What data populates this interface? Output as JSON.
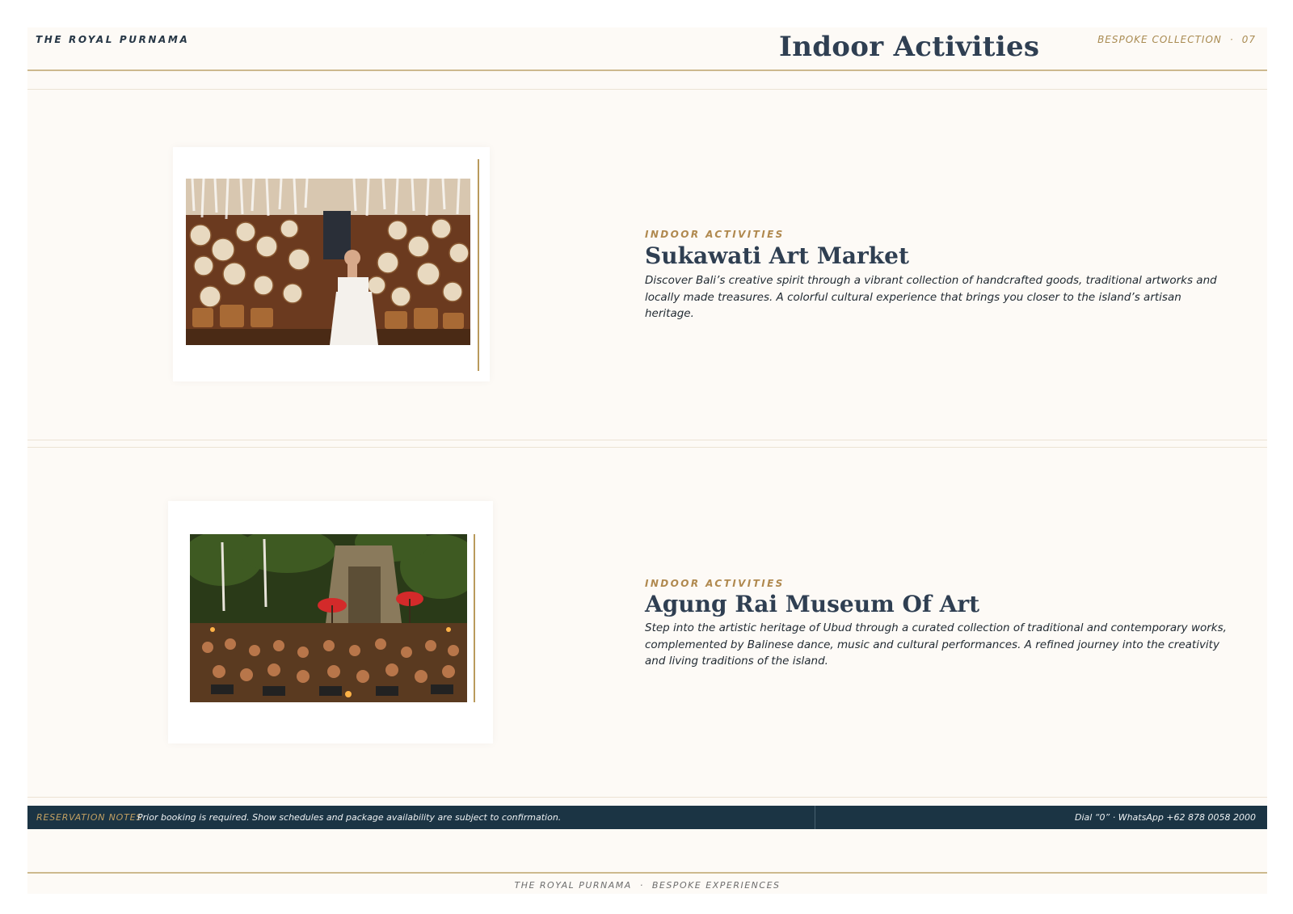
{
  "header": {
    "brand": "THE ROYAL PURNAMA",
    "title": "Indoor Activities",
    "collection_label": "BESPOKE COLLECTION",
    "separator": "·",
    "page_number": "07"
  },
  "activities": [
    {
      "eyebrow": "INDOOR ACTIVITIES",
      "title": "Sukawati Art Market",
      "description": "Discover Bali’s creative spirit through a vibrant collection of handcrafted goods, traditional artworks and locally made treasures. A colorful cultural experience that brings you closer to the island’s artisan heritage."
    },
    {
      "eyebrow": "INDOOR ACTIVITIES",
      "title": "Agung Rai Museum Of Art",
      "description": "Step into the artistic heritage of Ubud through a curated collection of traditional and contemporary works, complemented by Balinese dance, music and cultural performances. A refined journey into the creativity and living traditions of the island."
    }
  ],
  "reservation": {
    "label": "RESERVATION NOTES",
    "text": "Prior booking is required. Show schedules and package availability are subject to confirmation.",
    "contact": "Dial “0” · WhatsApp +62 878 0058 2000"
  },
  "footer": {
    "brand": "THE ROYAL PURNAMA",
    "separator": "·",
    "tagline": "BESPOKE EXPERIENCES"
  },
  "colors": {
    "accent_gold": "#b0894f",
    "navy": "#1b3444",
    "title_slate": "#2f3f52",
    "page_background": "#fdfaf6"
  }
}
